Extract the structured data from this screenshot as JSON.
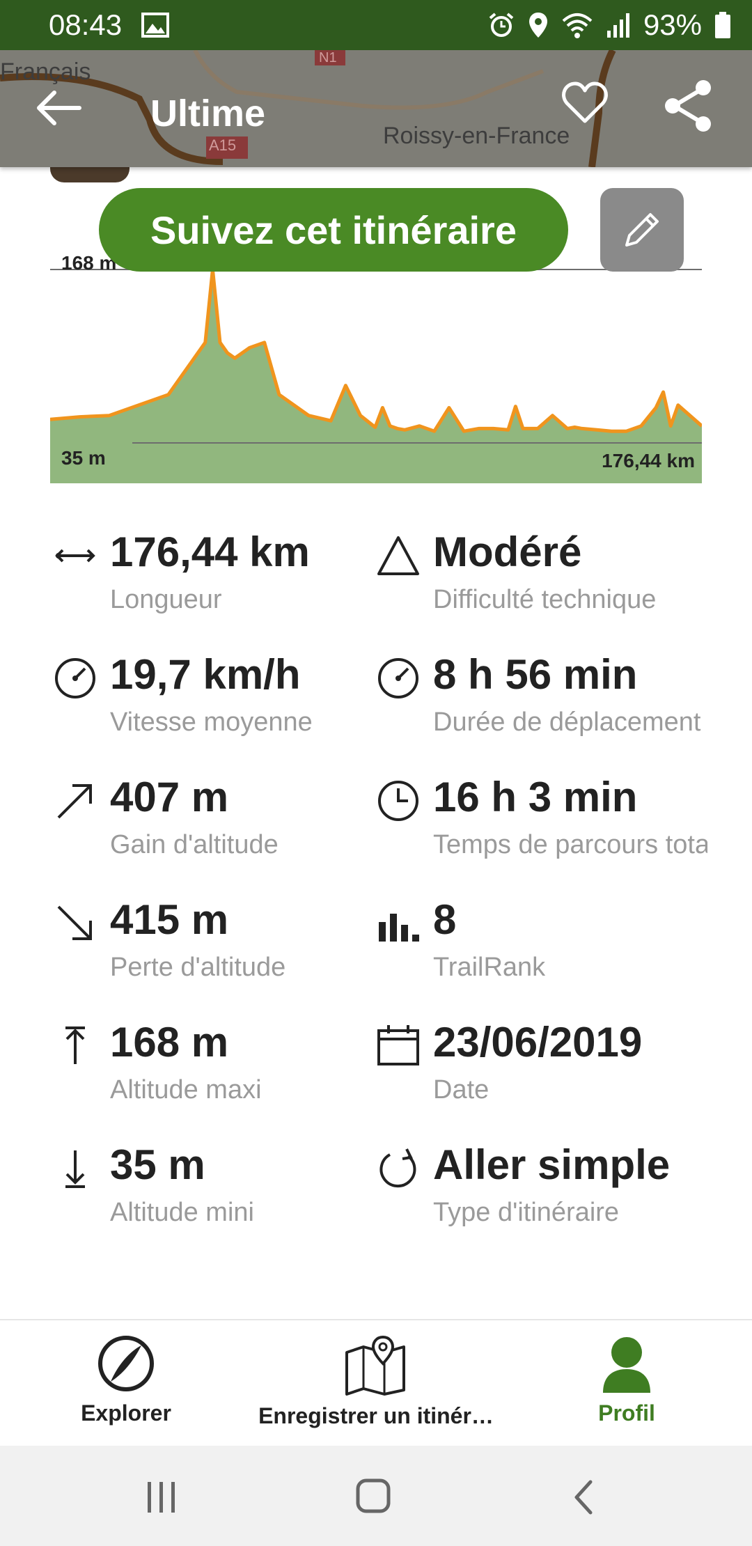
{
  "status_bar": {
    "time": "08:43",
    "battery": "93%"
  },
  "header": {
    "title": "Ultime",
    "map_labels": [
      "Français",
      "Roissy-en-France",
      "A15",
      "N1"
    ]
  },
  "actions": {
    "follow_label": "Suivez cet itinéraire"
  },
  "chart_data": {
    "type": "area",
    "title": "",
    "xlabel": "",
    "ylabel": "",
    "x_unit": "km",
    "y_unit": "m",
    "max_label": "168 m",
    "min_label": "35 m",
    "distance_label": "176,44 km",
    "xlim": [
      0,
      176.44
    ],
    "ylim": [
      35,
      168
    ],
    "x": [
      0,
      8,
      16,
      24,
      32,
      38,
      42,
      44,
      46,
      48,
      50,
      54,
      58,
      62,
      66,
      70,
      76,
      80,
      84,
      88,
      90,
      92,
      94,
      96,
      100,
      104,
      108,
      112,
      116,
      120,
      124,
      126,
      128,
      132,
      136,
      140,
      142,
      144,
      148,
      152,
      156,
      160,
      164,
      166,
      168,
      170,
      176.44
    ],
    "y": [
      53,
      55,
      56,
      64,
      72,
      96,
      112,
      168,
      112,
      104,
      100,
      108,
      112,
      72,
      64,
      56,
      52,
      79,
      56,
      47,
      62,
      48,
      46,
      45,
      48,
      44,
      62,
      44,
      46,
      46,
      45,
      63,
      46,
      46,
      56,
      46,
      47,
      46,
      45,
      44,
      44,
      48,
      62,
      74,
      48,
      64,
      48
    ],
    "series_color": "#f0941d",
    "fill_color": "#91b77e"
  },
  "stats": [
    {
      "icon": "arrow-both-icon",
      "value": "176,44 km",
      "label": "Longueur"
    },
    {
      "icon": "triangle-icon",
      "value": "Modéré",
      "label": "Difficulté technique"
    },
    {
      "icon": "speedometer-icon",
      "value": "19,7 km/h",
      "label": "Vitesse moyenne"
    },
    {
      "icon": "speedometer-icon",
      "value": "8 h 56 min",
      "label": "Durée de déplacement"
    },
    {
      "icon": "arrow-up-right-icon",
      "value": "407 m",
      "label": "Gain d'altitude"
    },
    {
      "icon": "clock-icon",
      "value": "16 h 3 min",
      "label": "Temps de parcours total"
    },
    {
      "icon": "arrow-down-right-icon",
      "value": "415 m",
      "label": "Perte d'altitude"
    },
    {
      "icon": "bar-chart-icon",
      "value": "8",
      "label": "TrailRank"
    },
    {
      "icon": "arrow-up-bar-icon",
      "value": "168 m",
      "label": "Altitude maxi"
    },
    {
      "icon": "calendar-icon",
      "value": "23/06/2019",
      "label": "Date"
    },
    {
      "icon": "arrow-down-bar-icon",
      "value": "35 m",
      "label": "Altitude mini"
    },
    {
      "icon": "loop-arrow-icon",
      "value": "Aller simple",
      "label": "Type d'itinéraire"
    }
  ],
  "bottom_nav": [
    {
      "icon": "compass-icon",
      "label": "Explorer",
      "active": false
    },
    {
      "icon": "map-pin-icon",
      "label": "Enregistrer un itinér…",
      "active": false
    },
    {
      "icon": "profile-icon",
      "label": "Profil",
      "active": true
    }
  ],
  "colors": {
    "brand_green": "#4a8a25",
    "status_green": "#2f5a1e",
    "active_green": "#3f7d22"
  }
}
